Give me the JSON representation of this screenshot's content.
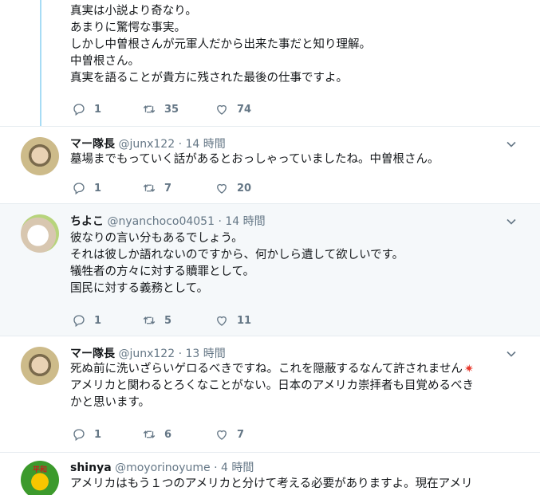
{
  "tweets": [
    {
      "body": [
        "真実は小説より奇なり。",
        "あまりに驚愕な事実。",
        "しかし中曽根さんが元軍人だから出来た事だと知り理解。",
        "中曽根さん。",
        "真実を語ることが貴方に残された最後の仕事ですよ。"
      ],
      "replies": "1",
      "retweets": "35",
      "likes": "74"
    },
    {
      "name": "マー隊長",
      "handle": "@junx122",
      "time": "· 14 時間",
      "body": [
        "墓場までもっていく話があるとおっしゃっていましたね。中曽根さん。"
      ],
      "replies": "1",
      "retweets": "7",
      "likes": "20"
    },
    {
      "name": "ちよこ",
      "handle": "@nyanchoco04051",
      "time": "· 14 時間",
      "body": [
        "彼なりの言い分もあるでしょう。",
        "それは彼しか語れないのですから、何かしら遺して欲しいです。",
        "犠牲者の方々に対する贖罪として。",
        "国民に対する義務として。"
      ],
      "replies": "1",
      "retweets": "5",
      "likes": "11"
    },
    {
      "name": "マー隊長",
      "handle": "@junx122",
      "time": "· 13 時間",
      "body": [
        "死ぬ前に洗いざらいゲロるべきですね。これを隠蔽するなんて許されません",
        "アメリカと関わるとろくなことがない。日本のアメリカ崇拝者も目覚めるべき",
        "かと思います。"
      ],
      "replies": "1",
      "retweets": "6",
      "likes": "7"
    },
    {
      "name": "shinya",
      "handle": "@moyorinoyume",
      "time": "· 4 時間",
      "avatar_text": "平和",
      "body": [
        "アメリカはもう１つのアメリカと分けて考える必要がありますよ。現在アメリ"
      ]
    }
  ],
  "icons": [
    "reply-icon",
    "retweet-icon",
    "like-icon",
    "chevron-down-icon",
    "anger-emoji-icon"
  ],
  "colors": {
    "thread_line": "#a8dcf5",
    "secondary_text": "#657786",
    "hover_bg": "#f5f8fa"
  }
}
